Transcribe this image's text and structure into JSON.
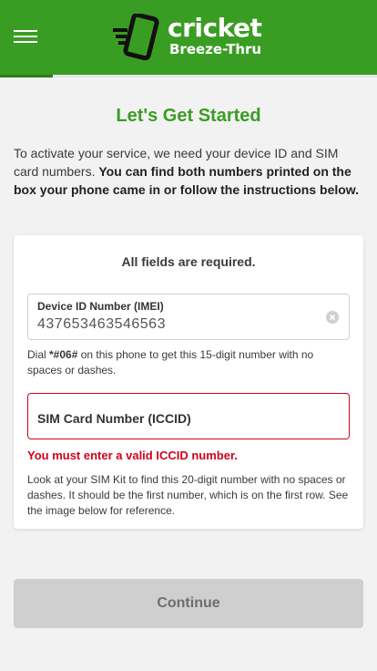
{
  "header": {
    "menu_icon": "hamburger-menu-icon",
    "logo_icon": "cricket-phone-logo-icon",
    "logo_word": "cricket",
    "logo_sub": "Breeze-Thru",
    "background_color": "#3a9d23"
  },
  "progress": {
    "fraction": 0.14
  },
  "page": {
    "title": "Let's Get Started",
    "intro_text": "To activate your service, we need your device ID and SIM card numbers. ",
    "intro_bold": "You can find both numbers printed on the box your phone came in or follow the instructions below."
  },
  "form": {
    "required_note": "All fields are required.",
    "imei": {
      "label": "Device ID Number (IMEI)",
      "value": "437653463546563",
      "clear_icon": "clear-circle-icon",
      "hint_pre": "Dial ",
      "hint_code": "*#06#",
      "hint_post": " on this phone to get this 15-digit number with no spaces or dashes."
    },
    "iccid": {
      "label": "SIM Card Number (ICCID)",
      "value": "",
      "error": "You must enter a valid ICCID number.",
      "hint": "Look at your SIM Kit to find this 20-digit number with no spaces or dashes. It should be the first number, which is on the first row. See the image below for reference."
    }
  },
  "actions": {
    "continue_label": "Continue"
  },
  "colors": {
    "brand_green": "#3a9d23",
    "error_red": "#d0021b",
    "disabled_button": "#cfcfcf"
  }
}
